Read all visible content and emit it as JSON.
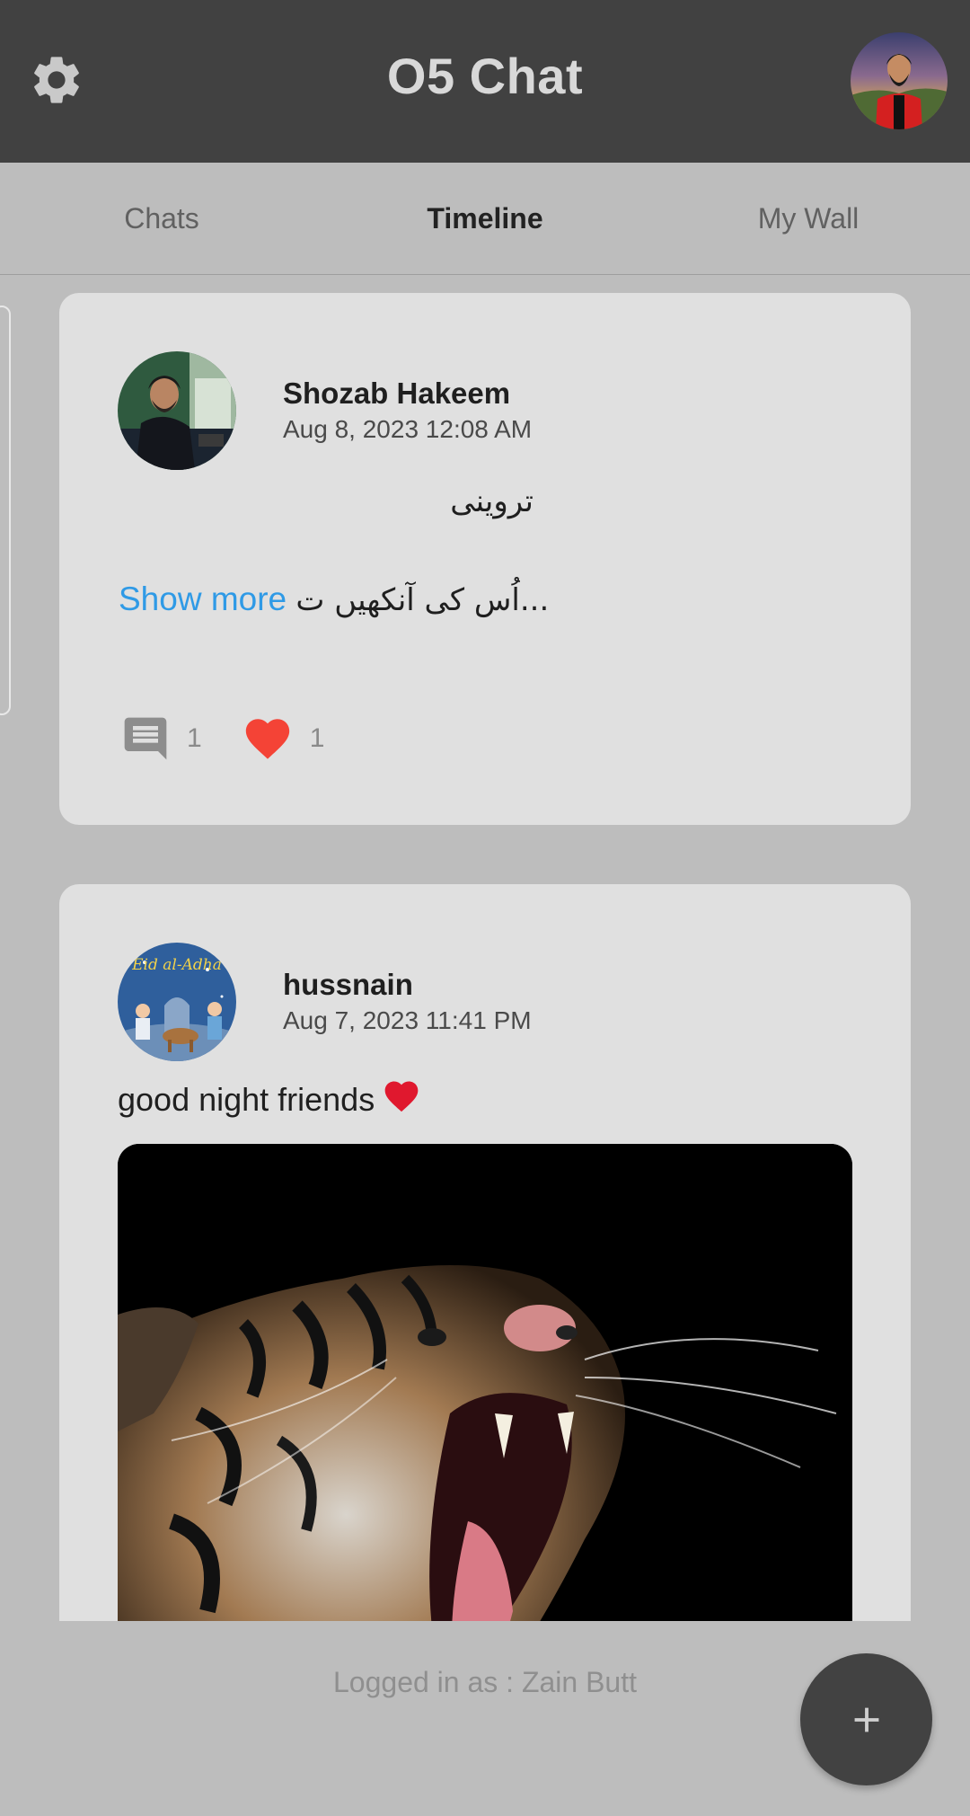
{
  "header": {
    "title": "O5 Chat",
    "settings_icon": "gear-icon",
    "profile_icon": "avatar"
  },
  "tabs": [
    {
      "label": "Chats",
      "active": false
    },
    {
      "label": "Timeline",
      "active": true
    },
    {
      "label": "My Wall",
      "active": false
    }
  ],
  "posts": [
    {
      "author": "Shozab Hakeem",
      "timestamp": "Aug 8, 2023 12:08 AM",
      "title": "تروینی",
      "show_more_label": "Show more",
      "excerpt": "اُس کی آنکھیں ت...",
      "comments_count": "1",
      "likes_count": "1"
    },
    {
      "author": "hussnain",
      "timestamp": "Aug 7, 2023 11:41 PM",
      "text": "good night friends",
      "avatar_caption": "Eid al-Adha"
    }
  ],
  "footer": {
    "logged_in_text": "Logged in as : Zain Butt",
    "fab_icon": "plus-icon"
  },
  "colors": {
    "header_bg": "#414141",
    "page_bg": "#bdbdbd",
    "card_bg": "#e0e0e0",
    "link": "#2f9ae6",
    "like": "#f44336"
  }
}
